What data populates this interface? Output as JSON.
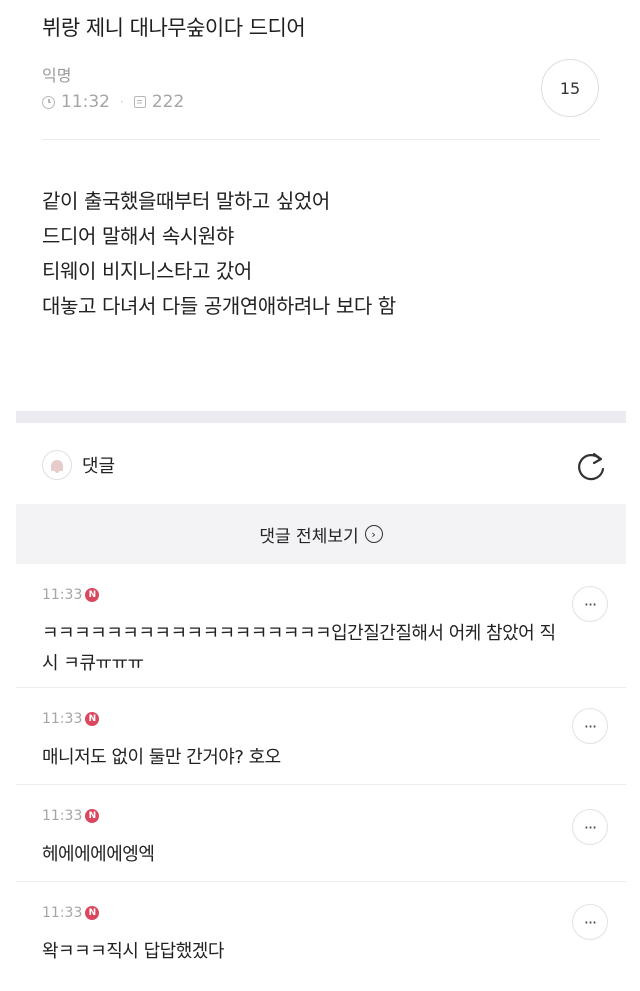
{
  "post": {
    "title": "뷔랑 제니 대나무숲이다 드디어",
    "author": "익명",
    "time": "11:32",
    "views": "222",
    "comment_count": "15",
    "body_lines": [
      "같이 출국했을때부터 말하고 싶었어",
      "드디어 말해서 속시원햐",
      "티웨이 비지니스타고 갔어",
      "대놓고 다녀서 다들 공개연애하려나 보다 함"
    ]
  },
  "comments_section": {
    "label": "댓글",
    "view_all_label": "댓글 전체보기",
    "new_badge": "N",
    "more_label": "···",
    "items": [
      {
        "time": "11:33",
        "text": "ㅋㅋㅋㅋㅋㅋㅋㅋㅋㅋㅋㅋㅋㅋㅋㅋㅋㅋ입간질간질해서 어케 참았어 직시 ㅋ큐ㅠㅠㅠ"
      },
      {
        "time": "11:33",
        "text": "매니저도 없이 둘만 간거야? 호오"
      },
      {
        "time": "11:33",
        "text": "헤에에에에엥엑"
      },
      {
        "time": "11:33",
        "text": "왁ㅋㅋㅋ직시 답답했겠다"
      }
    ]
  },
  "icons": {
    "clock": "clock-icon",
    "views": "views-icon",
    "bell": "bell-icon",
    "refresh": "refresh-icon",
    "arrow": "chevron-right-circle-icon",
    "more": "more-options-icon"
  },
  "colors": {
    "accent_badge": "#d9485f",
    "section_gap": "#ecebf1",
    "view_all_bg": "#f3f3f5"
  }
}
